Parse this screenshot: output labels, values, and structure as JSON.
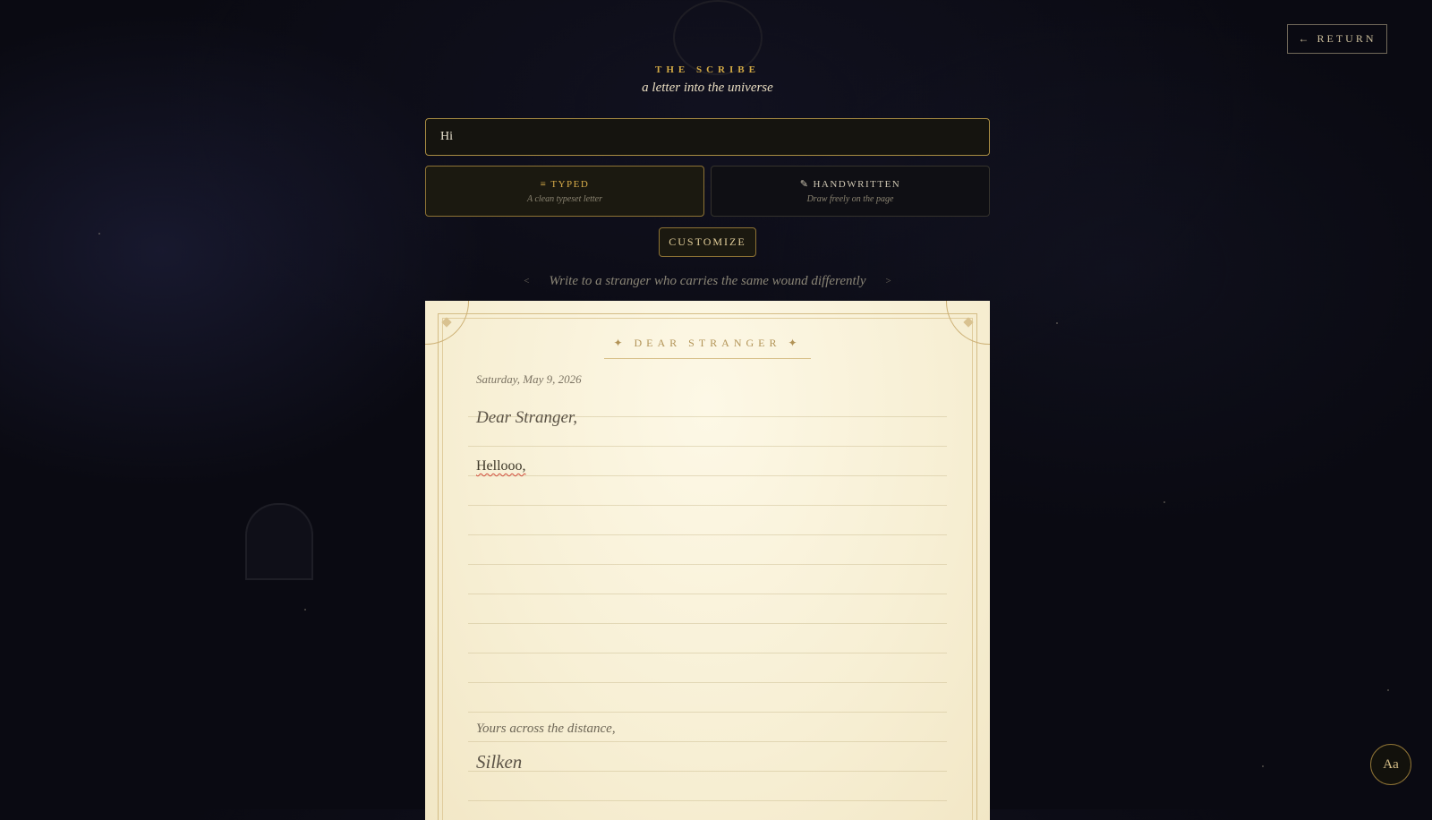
{
  "nav": {
    "return_label": "RETURN",
    "return_icon": "arrow-left-icon"
  },
  "header": {
    "eyebrow": "THE SCRIBE",
    "subtitle": "a letter into the universe"
  },
  "title_input": {
    "value": "Hi"
  },
  "modes": [
    {
      "icon": "≡",
      "label": "TYPED",
      "description": "A clean typeset letter",
      "selected": true
    },
    {
      "icon": "✎",
      "label": "HANDWRITTEN",
      "description": "Draw freely on the page",
      "selected": false
    }
  ],
  "customize_label": "CUSTOMIZE",
  "prompt": {
    "text": "Write to a stranger who carries the same wound differently",
    "prev_icon": "<",
    "next_icon": ">"
  },
  "letter": {
    "header": "✦  DEAR STRANGER  ✦",
    "date": "Saturday, May 9, 2026",
    "greeting": "Dear Stranger,",
    "body": "Hellooo,",
    "closing": "Yours across the distance,",
    "signature": "Silken"
  },
  "font_button_label": "Aa",
  "colors": {
    "accent": "#d3aa45",
    "background": "#0a0a12",
    "paper": "#f7efd4"
  }
}
